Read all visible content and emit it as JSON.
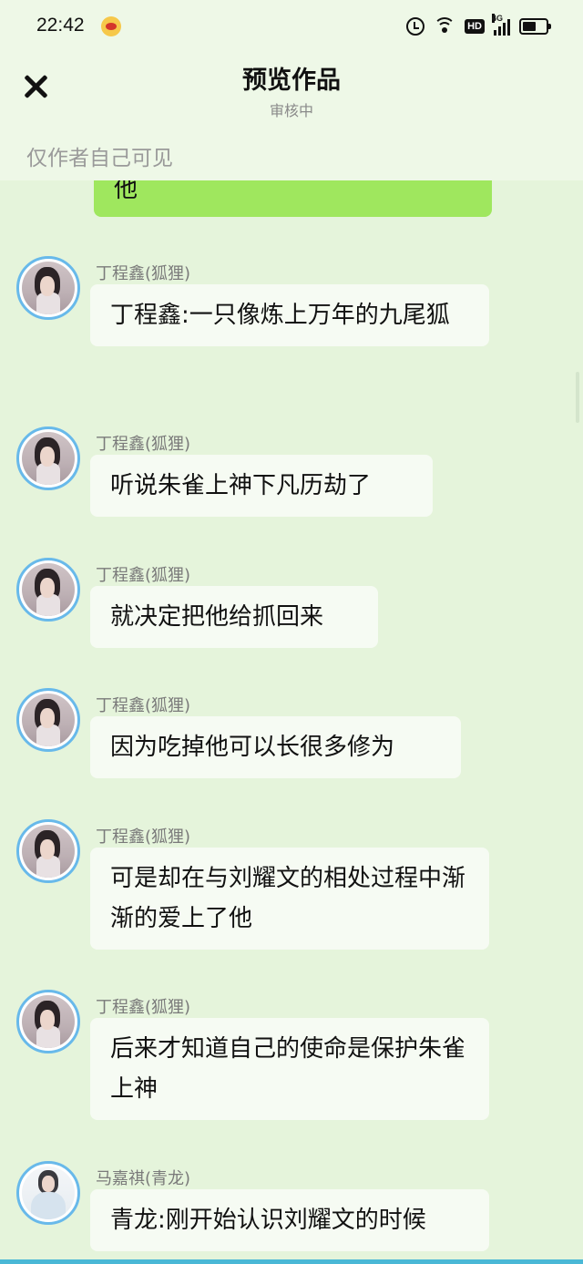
{
  "status_bar": {
    "time": "22:42",
    "network": "4G",
    "hd": "HD"
  },
  "header": {
    "title": "预览作品",
    "subtitle": "审核中",
    "visibility_note": "仅作者自己可见"
  },
  "colors": {
    "background": "#e5f4db",
    "header_background": "#eef8e7",
    "self_bubble": "#9fe75e",
    "other_bubble": "#f6fbf3",
    "avatar_ring": "#68b9ea"
  },
  "chat": {
    "partial_self_message": "他",
    "messages": [
      {
        "sender": "丁程鑫(狐狸)",
        "text": "丁程鑫:一只像炼上万年的九尾狐"
      },
      {
        "sender": "丁程鑫(狐狸)",
        "text": "听说朱雀上神下凡历劫了"
      },
      {
        "sender": "丁程鑫(狐狸)",
        "text": "就决定把他给抓回来"
      },
      {
        "sender": "丁程鑫(狐狸)",
        "text": "因为吃掉他可以长很多修为"
      },
      {
        "sender": "丁程鑫(狐狸)",
        "text": "可是却在与刘耀文的相处过程中渐渐的爱上了他"
      },
      {
        "sender": "丁程鑫(狐狸)",
        "text": "后来才知道自己的使命是保护朱雀上神"
      },
      {
        "sender": "马嘉祺(青龙)",
        "text": "青龙:刚开始认识刘耀文的时候"
      }
    ]
  }
}
